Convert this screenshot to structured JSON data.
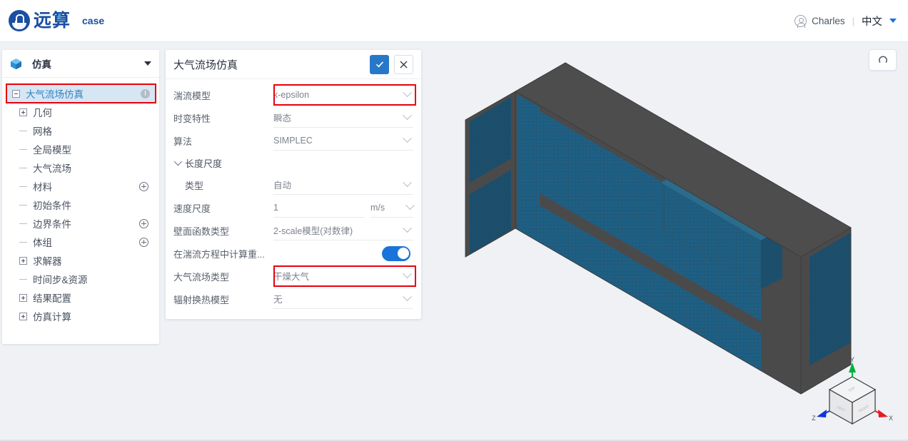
{
  "topbar": {
    "logo_text": "远算",
    "logo_icon": "yuansuan-logo-icon",
    "case_label": "case",
    "user_name": "Charles",
    "user_icon": "user-avatar-icon",
    "separator": "|",
    "language": "中文",
    "caret_icon": "caret-down-icon"
  },
  "sidebar": {
    "header": {
      "icon": "cube-icon",
      "title": "仿真",
      "caret": "caret-down-icon"
    },
    "tree": [
      {
        "label": "大气流场仿真",
        "toggle": "minus",
        "depth": 0,
        "selected": true,
        "badge": "info-icon"
      },
      {
        "label": "几何",
        "toggle": "plus",
        "depth": 1,
        "selected": false,
        "badge": ""
      },
      {
        "label": "网格",
        "toggle": "leaf",
        "depth": 1,
        "selected": false,
        "badge": ""
      },
      {
        "label": "全局模型",
        "toggle": "leaf",
        "depth": 1,
        "selected": false,
        "badge": ""
      },
      {
        "label": "大气流场",
        "toggle": "leaf",
        "depth": 1,
        "selected": false,
        "badge": ""
      },
      {
        "label": "材料",
        "toggle": "leaf",
        "depth": 1,
        "selected": false,
        "badge": "add-icon"
      },
      {
        "label": "初始条件",
        "toggle": "leaf",
        "depth": 1,
        "selected": false,
        "badge": ""
      },
      {
        "label": "边界条件",
        "toggle": "leaf",
        "depth": 1,
        "selected": false,
        "badge": "add-icon"
      },
      {
        "label": "体组",
        "toggle": "leaf",
        "depth": 1,
        "selected": false,
        "badge": "add-icon"
      },
      {
        "label": "求解器",
        "toggle": "plus",
        "depth": 1,
        "selected": false,
        "badge": ""
      },
      {
        "label": "时间步&资源",
        "toggle": "leaf",
        "depth": 1,
        "selected": false,
        "badge": ""
      },
      {
        "label": "结果配置",
        "toggle": "plus",
        "depth": 1,
        "selected": false,
        "badge": ""
      },
      {
        "label": "仿真计算",
        "toggle": "plus",
        "depth": 1,
        "selected": false,
        "badge": ""
      }
    ]
  },
  "panel": {
    "title": "大气流场仿真",
    "confirm_icon": "check-icon",
    "cancel_icon": "close-icon",
    "fields": [
      {
        "kind": "select",
        "label": "湍流模型",
        "value": "k-epsilon",
        "highlighted": true,
        "indent": false
      },
      {
        "kind": "select",
        "label": "时变特性",
        "value": "瞬态",
        "highlighted": false,
        "indent": false
      },
      {
        "kind": "select",
        "label": "算法",
        "value": "SIMPLEC",
        "highlighted": false,
        "indent": false
      },
      {
        "kind": "group",
        "label": "长度尺度",
        "value": "",
        "highlighted": false,
        "indent": false
      },
      {
        "kind": "select",
        "label": "类型",
        "value": "自动",
        "highlighted": false,
        "indent": true
      },
      {
        "kind": "unit",
        "label": "速度尺度",
        "value": "1",
        "unit": "m/s",
        "highlighted": false,
        "indent": false
      },
      {
        "kind": "select",
        "label": "壁面函数类型",
        "value": "2-scale模型(对数律)",
        "highlighted": false,
        "indent": false
      },
      {
        "kind": "toggle",
        "label": "在湍流方程中计算重...",
        "value": "on",
        "highlighted": false,
        "indent": false
      },
      {
        "kind": "select",
        "label": "大气流场类型",
        "value": "干燥大气",
        "highlighted": true,
        "indent": false
      },
      {
        "kind": "select",
        "label": "辐射换热模型",
        "value": "无",
        "highlighted": false,
        "indent": false
      }
    ]
  },
  "viewport": {
    "reset_icon": "reset-view-icon",
    "triad": {
      "x_label": "X",
      "y_label": "Y",
      "z_label": "Z",
      "face_top": "TOP",
      "face_left": "LEFT",
      "face_right": "RIGHT"
    },
    "model_name": "atmospheric-mesh-block"
  },
  "colors": {
    "brand_blue": "#1a4fa0",
    "accent_blue": "#2878c8",
    "highlight_red": "#e8000d",
    "selection_blue": "#d6e6f2",
    "mesh_teal": "#1d5f84",
    "mesh_gray": "#4a4a4a",
    "canvas_bg": "#eff1f5",
    "axis_x": "#e11d22",
    "axis_y": "#00b03c",
    "axis_z": "#1035d8"
  }
}
